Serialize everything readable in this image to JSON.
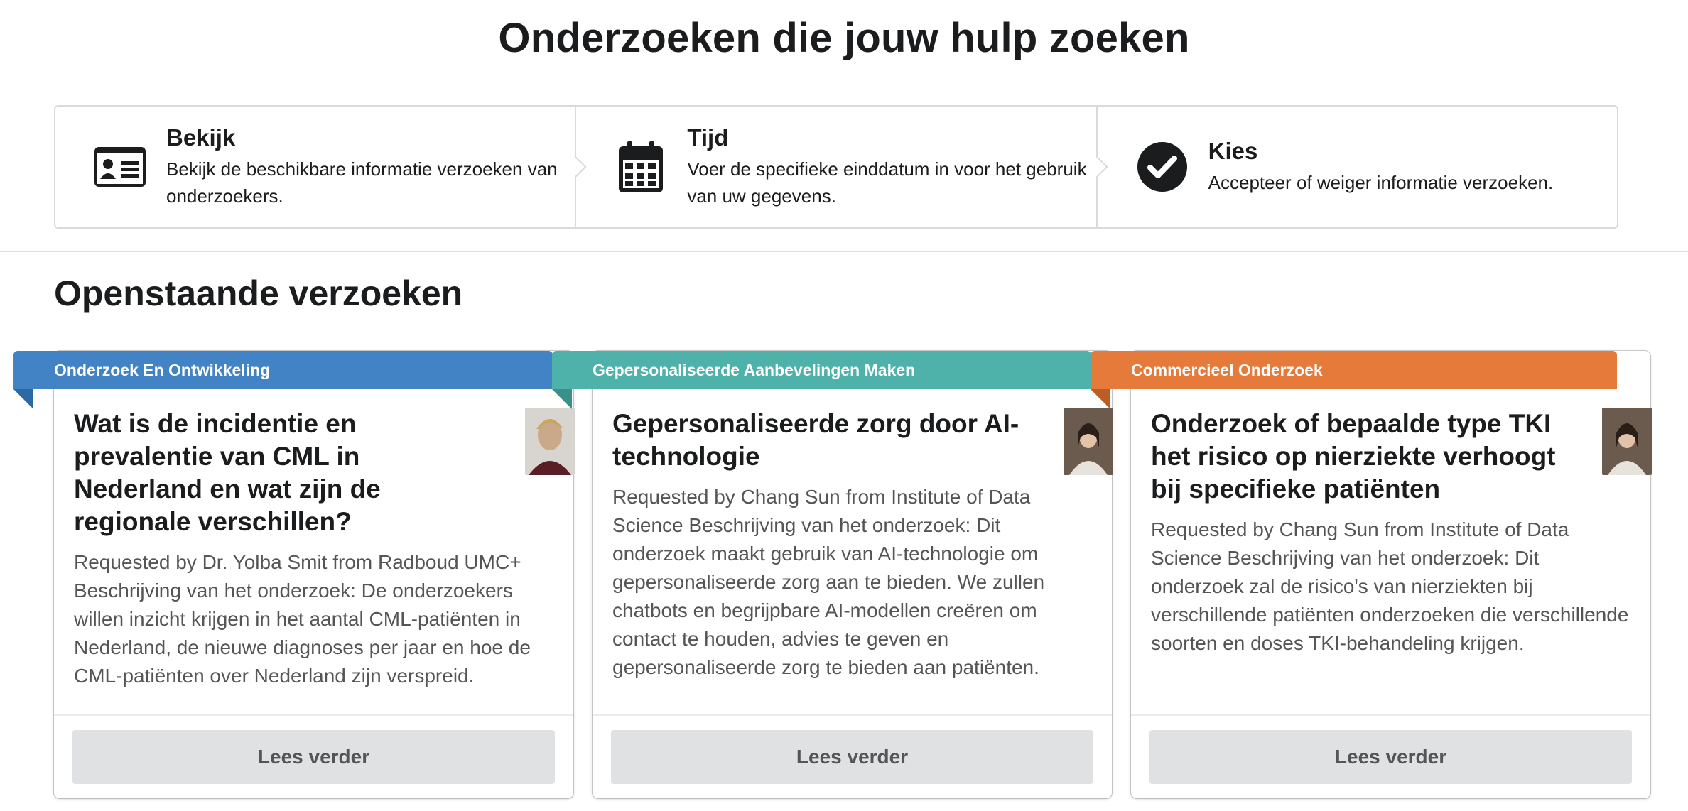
{
  "header": {
    "title": "Onderzoeken die jouw hulp zoeken"
  },
  "steps": [
    {
      "title": "Bekijk",
      "desc": "Bekijk de beschikbare informatie verzoeken van onderzoekers.",
      "icon": "id-card-icon"
    },
    {
      "title": "Tijd",
      "desc": "Voer de specifieke einddatum in voor het gebruik van uw gegevens.",
      "icon": "calendar-icon"
    },
    {
      "title": "Kies",
      "desc": "Accepteer of weiger informatie verzoeken.",
      "icon": "check-circle-icon"
    }
  ],
  "section": {
    "title": "Openstaande verzoeken"
  },
  "cards": [
    {
      "category": "Onderzoek En Ontwikkeling",
      "category_color": "#4183c4",
      "title": "Wat is de incidentie en prevalentie van CML in Nederland en wat zijn de regionale verschillen?",
      "description": "Requested by Dr. Yolba Smit from Radboud UMC+ Beschrijving van het onderzoek: De onderzoekers willen inzicht krijgen in het aantal CML-patiënten in Nederland, de nieuwe diagnoses per jaar en hoe de CML-patiënten over Nederland zijn verspreid.",
      "button": "Lees verder"
    },
    {
      "category": "Gepersonaliseerde Aanbevelingen Maken",
      "category_color": "#4fb2aa",
      "title": "Gepersonaliseerde zorg door AI-technologie",
      "description": "Requested by Chang Sun from Institute of Data Science Beschrijving van het onderzoek: Dit onderzoek maakt gebruik van AI-technologie om gepersonaliseerde zorg aan te bieden. We zullen chatbots en begrijpbare AI-modellen creëren om contact te houden, advies te geven en gepersonaliseerde zorg te bieden aan patiënten.",
      "button": "Lees verder"
    },
    {
      "category": "Commercieel Onderzoek",
      "category_color": "#e57a3a",
      "title": "Onderzoek of bepaalde type TKI het risico op nierziekte verhoogt bij specifieke patiënten",
      "description": "Requested by Chang Sun from Institute of Data Science Beschrijving van het onderzoek: Dit onderzoek zal de risico's van nierziekten bij verschillende patiënten onderzoeken die verschillende soorten en doses TKI-behandeling krijgen.",
      "button": "Lees verder"
    }
  ]
}
